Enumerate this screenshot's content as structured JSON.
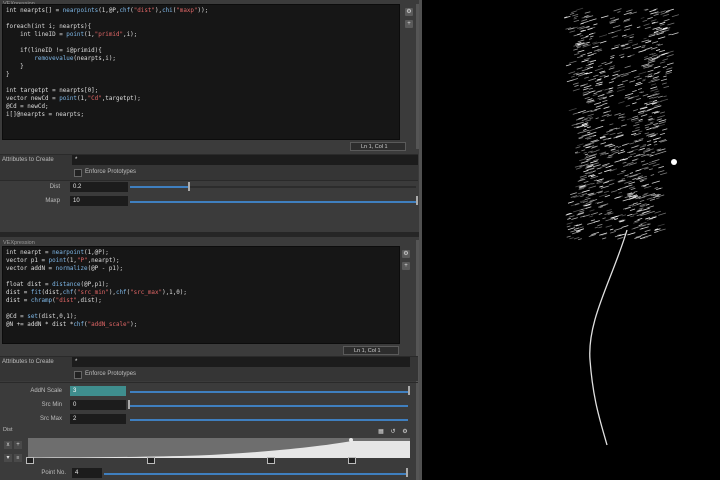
{
  "top_panel": {
    "title": "VEXpression",
    "code_lines": [
      [
        {
          "t": "int nearpts[] = "
        },
        {
          "t": "nearpoints",
          "c": "fn"
        },
        {
          "t": "(1,@P,"
        },
        {
          "t": "chf",
          "c": "fn"
        },
        {
          "t": "("
        },
        {
          "t": "\"dist\"",
          "c": "str"
        },
        {
          "t": "),"
        },
        {
          "t": "chi",
          "c": "fn"
        },
        {
          "t": "("
        },
        {
          "t": "\"maxp\"",
          "c": "str"
        },
        {
          "t": "));"
        }
      ],
      [
        {
          "t": ""
        }
      ],
      [
        {
          "t": "foreach(int i; nearpts){"
        }
      ],
      [
        {
          "t": "    int lineID = "
        },
        {
          "t": "point",
          "c": "fn"
        },
        {
          "t": "(1,"
        },
        {
          "t": "\"primid\"",
          "c": "str"
        },
        {
          "t": ",i);"
        }
      ],
      [
        {
          "t": ""
        }
      ],
      [
        {
          "t": "    if(lineID != i@primid){"
        }
      ],
      [
        {
          "t": "        "
        },
        {
          "t": "removevalue",
          "c": "fn"
        },
        {
          "t": "(nearpts,i);"
        }
      ],
      [
        {
          "t": "    }"
        }
      ],
      [
        {
          "t": "}"
        }
      ],
      [
        {
          "t": ""
        }
      ],
      [
        {
          "t": "int targetpt = nearpts[0];"
        }
      ],
      [
        {
          "t": "vector newCd = "
        },
        {
          "t": "point",
          "c": "fn"
        },
        {
          "t": "(1,"
        },
        {
          "t": "\"Cd\"",
          "c": "str"
        },
        {
          "t": ",targetpt);"
        }
      ],
      [
        {
          "t": "@Cd = newCd;"
        }
      ],
      [
        {
          "t": "i[]@nearpts = nearpts;"
        }
      ]
    ],
    "status": "Ln 1, Col 1",
    "attributes_label": "Attributes to Create",
    "attributes_value": "*",
    "enforce_label": "Enforce Prototypes",
    "params": [
      {
        "label": "Dist",
        "value": "0.2",
        "fill": 0.36
      },
      {
        "label": "Maxp",
        "value": "10",
        "fill": 0.0
      }
    ]
  },
  "bottom_panel": {
    "title": "VEXpression",
    "code_lines": [
      [
        {
          "t": "int nearpt = "
        },
        {
          "t": "nearpoint",
          "c": "fn"
        },
        {
          "t": "(1,@P);"
        }
      ],
      [
        {
          "t": "vector p1 = "
        },
        {
          "t": "point",
          "c": "fn"
        },
        {
          "t": "(1,"
        },
        {
          "t": "\"P\"",
          "c": "str"
        },
        {
          "t": ",nearpt);"
        }
      ],
      [
        {
          "t": "vector addN = "
        },
        {
          "t": "normalize",
          "c": "fn"
        },
        {
          "t": "(@P - p1);"
        }
      ],
      [
        {
          "t": ""
        }
      ],
      [
        {
          "t": "float dist = "
        },
        {
          "t": "distance",
          "c": "fn"
        },
        {
          "t": "(@P,p1);"
        }
      ],
      [
        {
          "t": "dist = "
        },
        {
          "t": "fit",
          "c": "fn"
        },
        {
          "t": "(dist,"
        },
        {
          "t": "chf",
          "c": "fn"
        },
        {
          "t": "("
        },
        {
          "t": "\"src_min\"",
          "c": "str"
        },
        {
          "t": "),"
        },
        {
          "t": "chf",
          "c": "fn"
        },
        {
          "t": "("
        },
        {
          "t": "\"src_max\"",
          "c": "str"
        },
        {
          "t": "),1,0);"
        }
      ],
      [
        {
          "t": "dist = "
        },
        {
          "t": "chramp",
          "c": "fn"
        },
        {
          "t": "("
        },
        {
          "t": "\"dist\"",
          "c": "str"
        },
        {
          "t": ",dist);"
        }
      ],
      [
        {
          "t": ""
        }
      ],
      [
        {
          "t": "@Cd = "
        },
        {
          "t": "set",
          "c": "fn"
        },
        {
          "t": "(dist,0,1);"
        }
      ],
      [
        {
          "t": "@N += addN * dist *"
        },
        {
          "t": "chf",
          "c": "fn"
        },
        {
          "t": "("
        },
        {
          "t": "\"addN_scale\"",
          "c": "str"
        },
        {
          "t": ");"
        }
      ]
    ],
    "status": "Ln 1, Col 1",
    "attributes_label": "Attributes to Create",
    "attributes_value": "*",
    "enforce_label": "Enforce Prototypes",
    "params": [
      {
        "label": "AddN Scale",
        "value": "3",
        "fill": 0.0
      },
      {
        "label": "Src Min",
        "value": "0",
        "fill": 0.0
      },
      {
        "label": "Src Max",
        "value": "2",
        "fill": 0.0
      }
    ],
    "ramp_label": "Dist",
    "point_label": "Point No.",
    "point_value": "4"
  },
  "icons": {
    "add": "+",
    "remove": "x",
    "expand": "▾"
  },
  "colors": {
    "accent": "#3f7fbf",
    "teal_field": "#3f8e8e",
    "code_bg": "#161616",
    "viewport_bg": "#000000"
  }
}
